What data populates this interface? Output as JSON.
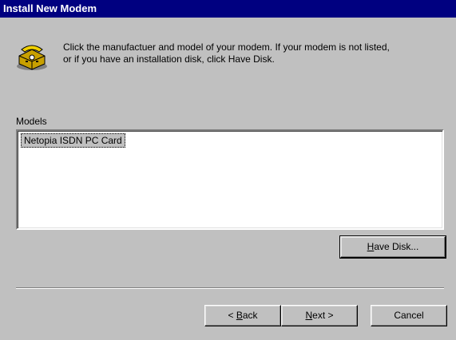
{
  "window": {
    "title": "Install New Modem"
  },
  "icons": {
    "header_icon": "modem-phone-icon"
  },
  "instructions": {
    "text": "Click the manufactuer and model of your modem. If your modem is not listed,\nor if you have an installation disk, click Have Disk."
  },
  "models": {
    "label": "Models",
    "items": [
      {
        "label": "Netopia ISDN PC Card",
        "selected": true
      }
    ]
  },
  "buttons": {
    "have_disk": {
      "mnemonic": "H",
      "rest": "ave Disk..."
    },
    "back": {
      "prefix": "< ",
      "mnemonic": "B",
      "rest": "ack"
    },
    "next": {
      "mnemonic": "N",
      "rest": "ext >"
    },
    "cancel": "Cancel"
  },
  "colors": {
    "titlebar": "#000080",
    "face": "#c0c0c0",
    "list_background": "#ffffff",
    "selection_background": "#c0c0c0"
  }
}
